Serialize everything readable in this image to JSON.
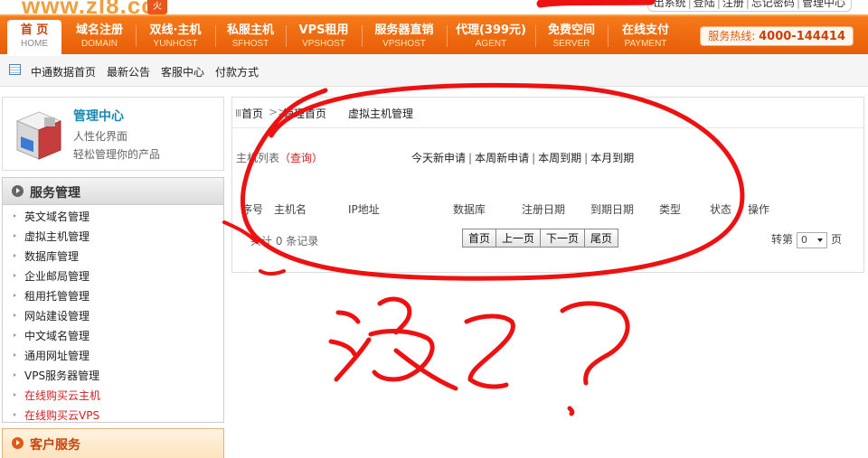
{
  "topbar": {
    "logo_text": "www.zl8.cc",
    "logo_badge": "火",
    "links": [
      "出系统",
      "登陆",
      "注册",
      "忘记密码",
      "管理中心"
    ]
  },
  "nav": {
    "items": [
      {
        "cn": "首 页",
        "en": "HOME"
      },
      {
        "cn": "域名注册",
        "en": "DOMAIN"
      },
      {
        "cn": "双线·主机",
        "en": "YUNHOST"
      },
      {
        "cn": "私服主机",
        "en": "SFHOST"
      },
      {
        "cn": "VPS租用",
        "en": "VPSHOST"
      },
      {
        "cn": "服务器直销",
        "en": "VPSHOST"
      },
      {
        "cn": "代理(399元)",
        "en": "AGENT"
      },
      {
        "cn": "免费空间",
        "en": "SERVER"
      },
      {
        "cn": "在线支付",
        "en": "PAYMENT"
      }
    ],
    "hotline_label": "服务热线:",
    "hotline_number": "4000-144414"
  },
  "subnav": {
    "links": [
      "中通数据首页",
      "最新公告",
      "客服中心",
      "付款方式"
    ]
  },
  "manager": {
    "title": "管理中心",
    "line1": "人性化界面",
    "line2": "轻松管理你的产品"
  },
  "services": {
    "title": "服务管理",
    "items": [
      {
        "label": "英文域名管理"
      },
      {
        "label": "虚拟主机管理"
      },
      {
        "label": "数据库管理"
      },
      {
        "label": "企业邮局管理"
      },
      {
        "label": "租用托管管理"
      },
      {
        "label": "网站建设管理"
      },
      {
        "label": "中文域名管理"
      },
      {
        "label": "通用网址管理"
      },
      {
        "label": "VPS服务器管理"
      },
      {
        "label": "在线购买云主机"
      },
      {
        "label": "在线购买云VPS"
      }
    ]
  },
  "customer": {
    "title": "客户服务"
  },
  "breadcrumb": {
    "home": "首页",
    "arrow": ">>",
    "panel": "管理首页",
    "current": "虚拟主机管理"
  },
  "hostlist": {
    "title": "主机列表",
    "query": "（查询）",
    "filters": [
      "今天新申请",
      "本周新申请",
      "本周到期",
      "本月到期"
    ],
    "columns": [
      "序号",
      "主机名",
      "IP地址",
      "数据库",
      "注册日期",
      "到期日期",
      "类型",
      "状态",
      "操作"
    ],
    "total": "共计 0 条记录",
    "pager": [
      "首页",
      "上一页",
      "下一页",
      "尾页"
    ],
    "goto_prefix": "转第",
    "goto_value": "0",
    "goto_suffix": "页"
  },
  "annotation": {
    "text": "没了?",
    "color": "#ee1111"
  }
}
